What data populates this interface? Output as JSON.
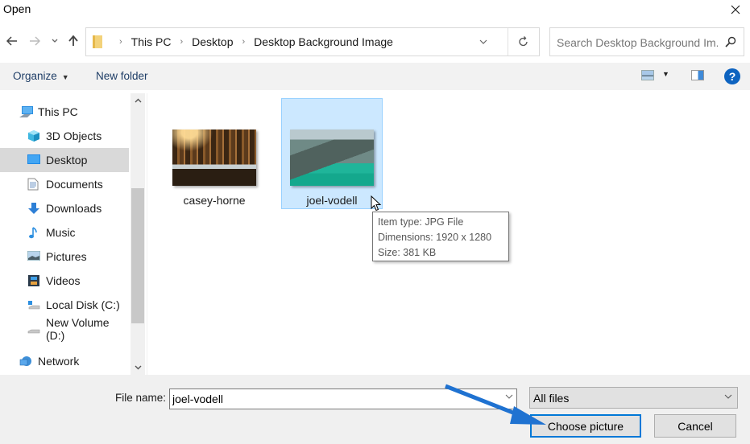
{
  "window": {
    "title": "Open",
    "close_icon": "close-icon"
  },
  "nav": {
    "back_icon": "arrow-left-icon",
    "forward_icon": "arrow-right-icon",
    "recent_icon": "chevron-down-icon",
    "up_icon": "arrow-up-icon",
    "breadcrumb": [
      "This PC",
      "Desktop",
      "Desktop Background Image"
    ],
    "refresh_icon": "refresh-icon",
    "search_placeholder": "Search Desktop Background Im...",
    "search_icon": "search-icon"
  },
  "toolbar": {
    "organize_label": "Organize",
    "new_folder_label": "New folder",
    "view_icon": "change-view-icon",
    "preview_pane_icon": "preview-pane-icon",
    "help_icon": "help-icon"
  },
  "sidebar": {
    "items": [
      {
        "label": "This PC",
        "icon": "computer-icon",
        "selected": false,
        "level": 0
      },
      {
        "label": "3D Objects",
        "icon": "cube-icon",
        "selected": false,
        "level": 1
      },
      {
        "label": "Desktop",
        "icon": "desktop-icon",
        "selected": true,
        "level": 1
      },
      {
        "label": "Documents",
        "icon": "document-icon",
        "selected": false,
        "level": 1
      },
      {
        "label": "Downloads",
        "icon": "download-icon",
        "selected": false,
        "level": 1
      },
      {
        "label": "Music",
        "icon": "music-icon",
        "selected": false,
        "level": 1
      },
      {
        "label": "Pictures",
        "icon": "pictures-icon",
        "selected": false,
        "level": 1
      },
      {
        "label": "Videos",
        "icon": "video-icon",
        "selected": false,
        "level": 1
      },
      {
        "label": "Local Disk (C:)",
        "icon": "drive-icon",
        "selected": false,
        "level": 1
      },
      {
        "label": "New Volume (D:)",
        "icon": "drive-icon",
        "selected": false,
        "level": 1
      },
      {
        "label": "Network",
        "icon": "network-icon",
        "selected": false,
        "level": 0
      }
    ]
  },
  "files": [
    {
      "name": "casey-horne",
      "selected": false
    },
    {
      "name": "joel-vodell",
      "selected": true
    }
  ],
  "tooltip": {
    "lines": [
      "Item type: JPG File",
      "Dimensions: 1920 x 1280",
      "Size: 381 KB"
    ]
  },
  "footer": {
    "file_name_label": "File name:",
    "file_name_value": "joel-vodell",
    "file_type_value": "All files",
    "choose_label": "Choose picture",
    "cancel_label": "Cancel"
  },
  "colors": {
    "accent": "#0078d7",
    "selection_bg": "#cce8ff",
    "selection_border": "#99d1ff",
    "annotation_arrow": "#1f72d1"
  }
}
